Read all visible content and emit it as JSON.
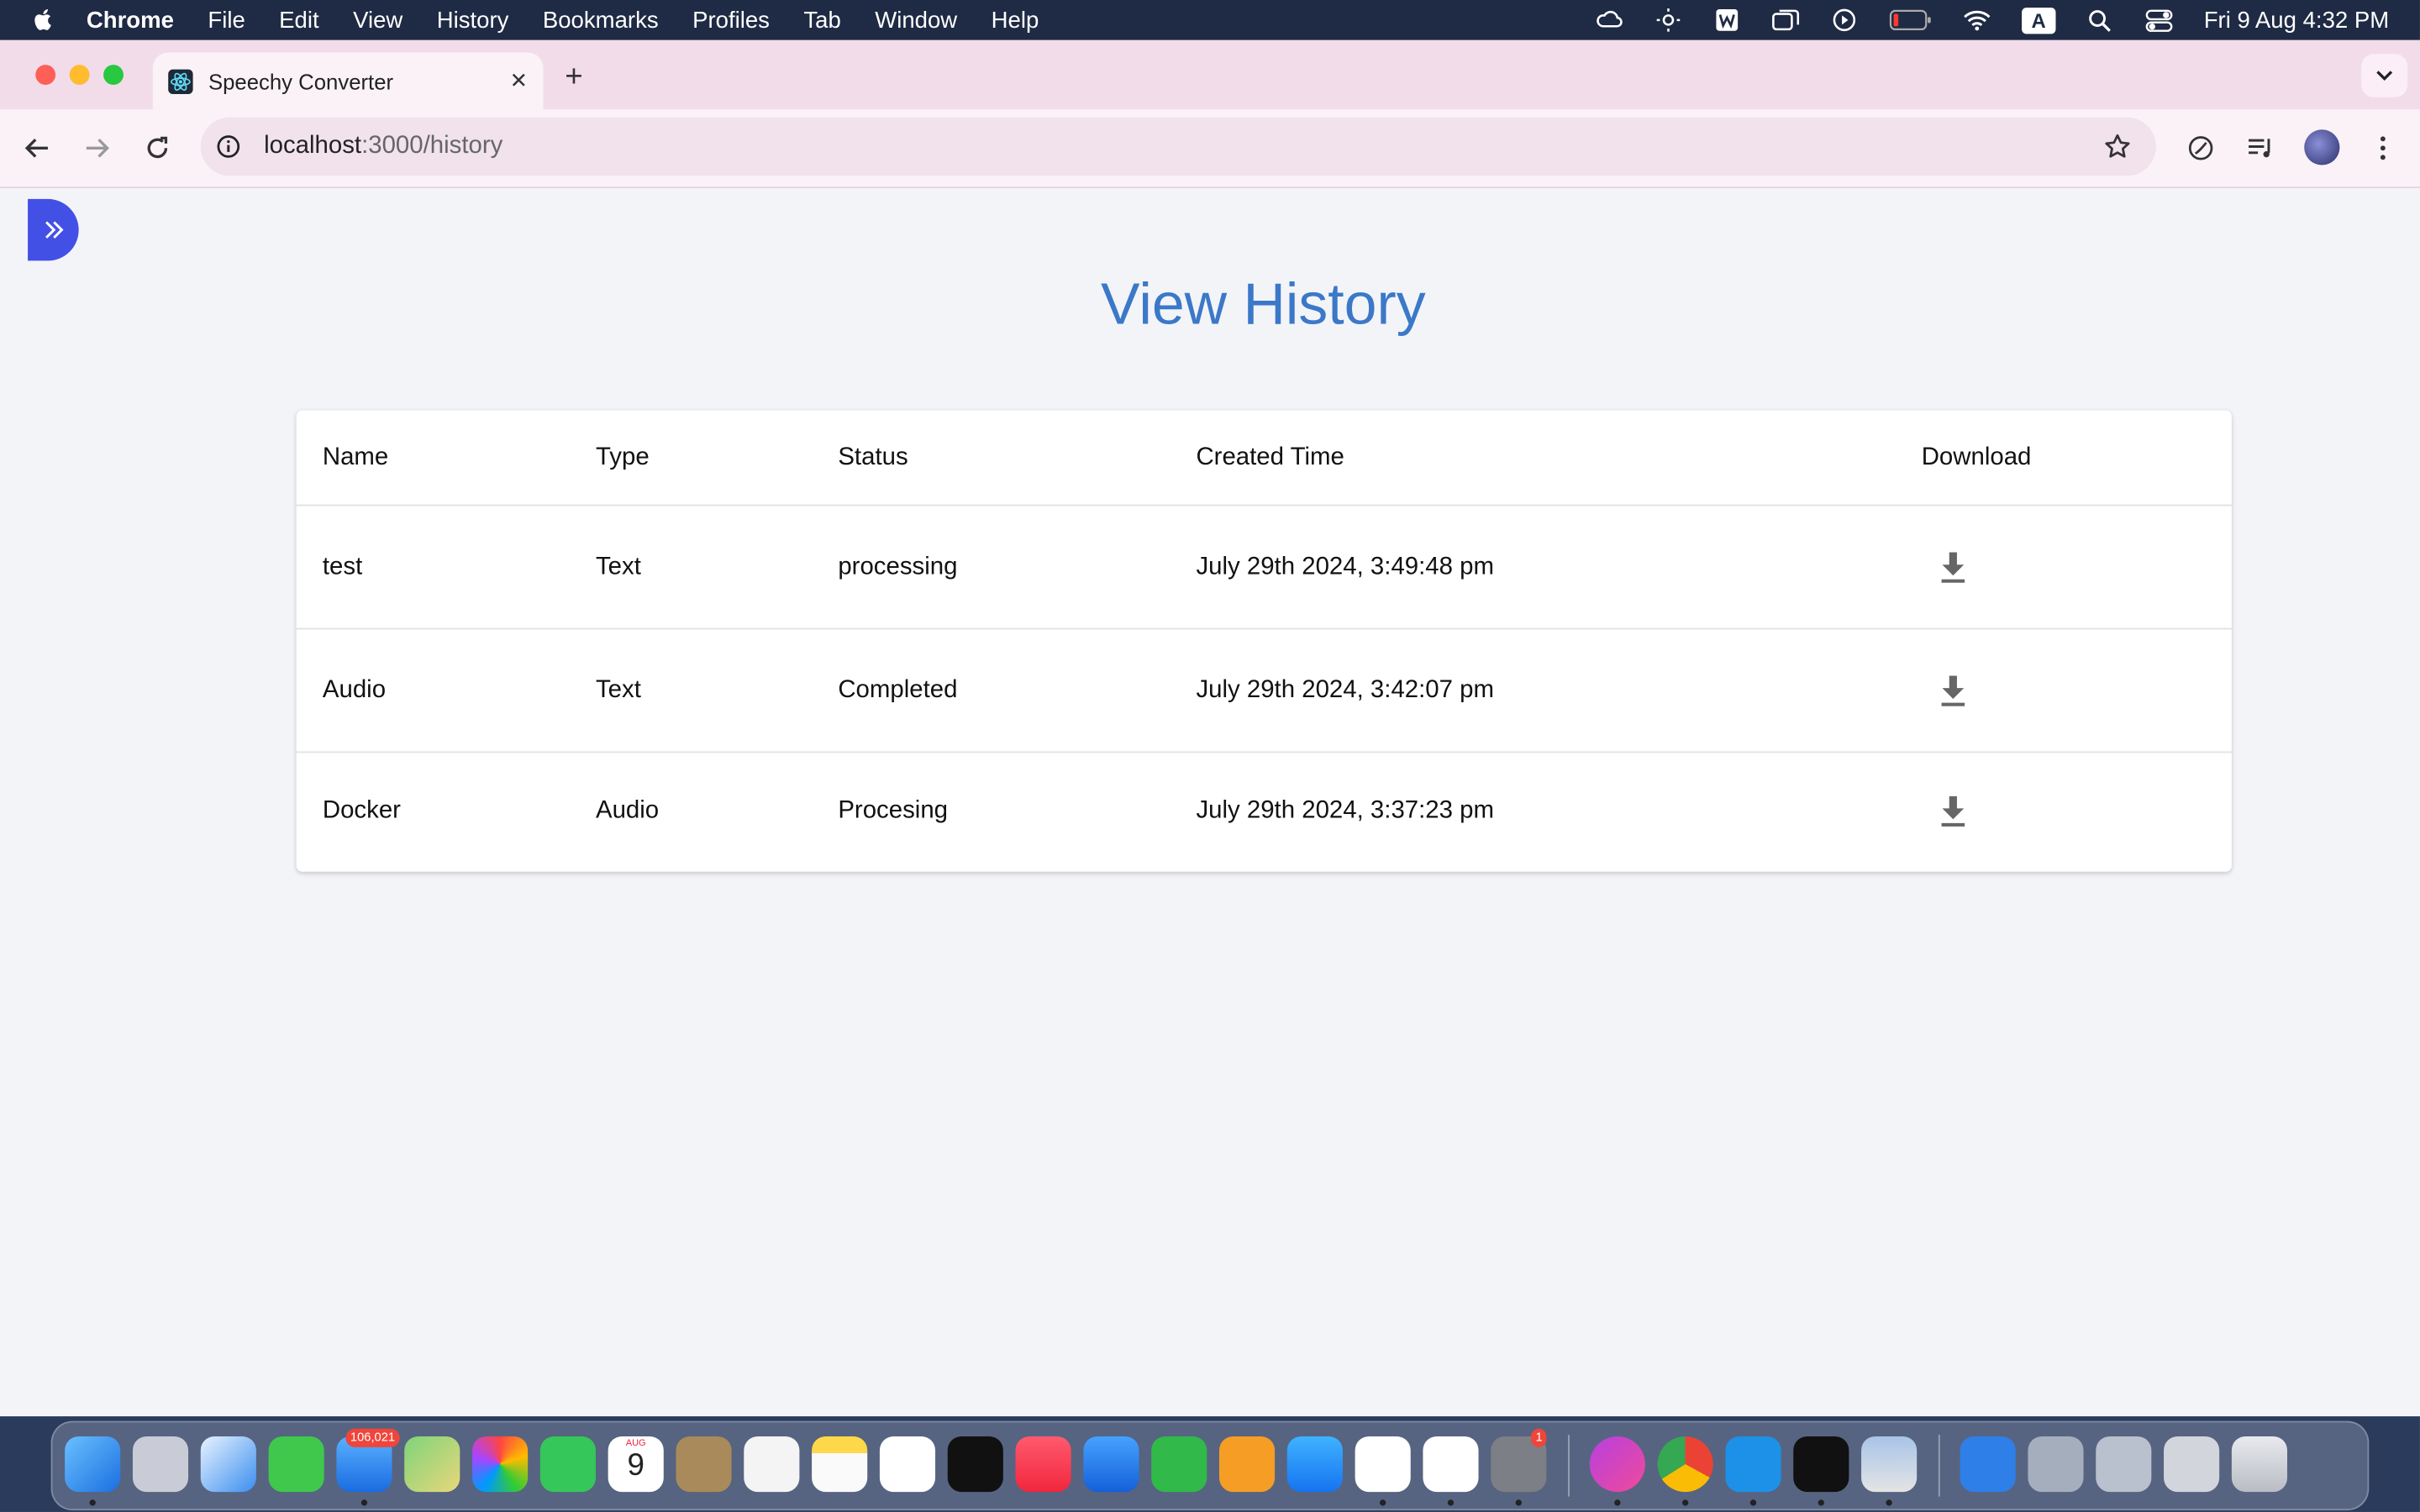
{
  "menubar": {
    "app_name": "Chrome",
    "items": [
      "File",
      "Edit",
      "View",
      "History",
      "Bookmarks",
      "Profiles",
      "Tab",
      "Window",
      "Help"
    ],
    "clock": "Fri 9 Aug  4:32 PM",
    "input_indicator": "A"
  },
  "browser": {
    "tab_title": "Speechy Converter",
    "url_host": "localhost",
    "url_path": ":3000/history"
  },
  "page": {
    "title": "View History",
    "columns": [
      "Name",
      "Type",
      "Status",
      "Created Time",
      "Download"
    ],
    "rows": [
      {
        "name": "test",
        "type": "Text",
        "status": "processing",
        "created": "July 29th 2024, 3:49:48 pm"
      },
      {
        "name": "Audio",
        "type": "Text",
        "status": "Completed",
        "created": "July 29th 2024, 3:42:07 pm"
      },
      {
        "name": "Docker",
        "type": "Audio",
        "status": "Procesing",
        "created": "July 29th 2024, 3:37:23 pm"
      }
    ]
  },
  "dock": {
    "mail_badge": "106,021",
    "calendar_month": "AUG",
    "calendar_day": "9",
    "settings_badge": "1"
  },
  "colors": {
    "accent": "#3b78c8",
    "sidebar_toggle": "#4350e6",
    "tab_strip": "#f2dcea"
  }
}
